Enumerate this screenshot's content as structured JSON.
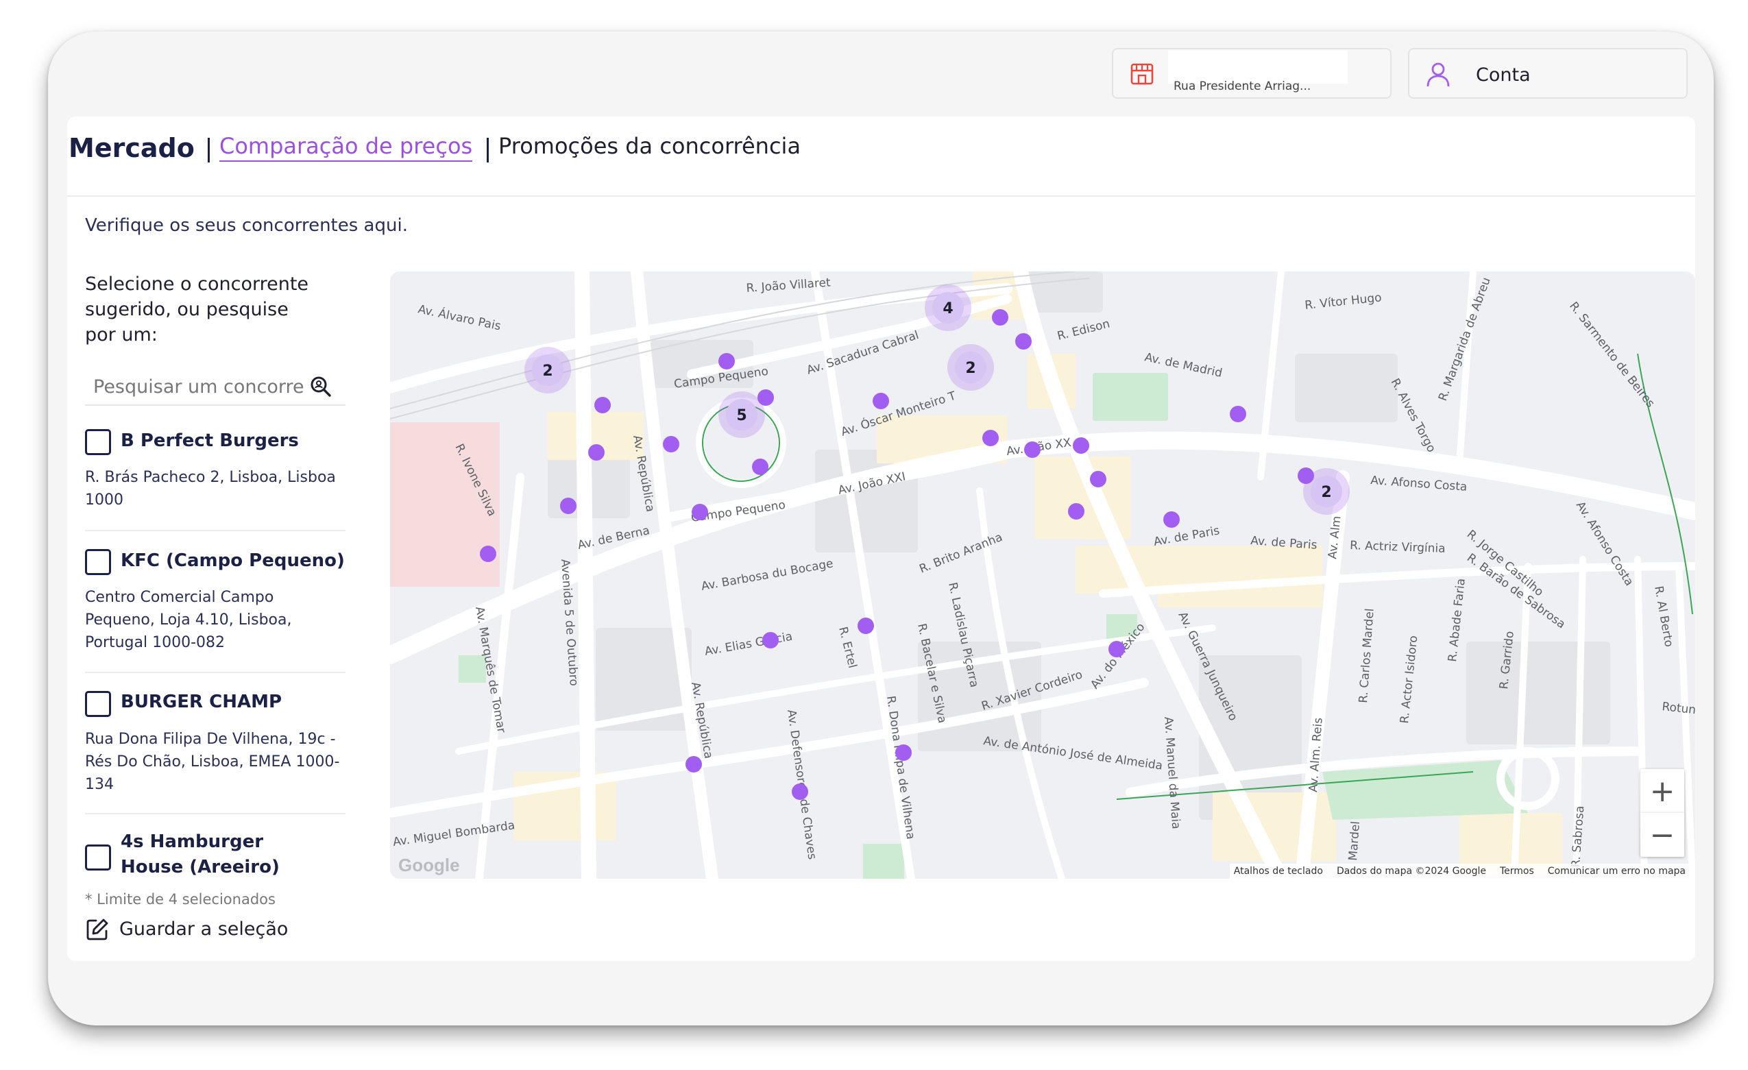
{
  "header": {
    "store_address": "Rua Presidente Arriag...",
    "account_label": "Conta"
  },
  "nav": {
    "title": "Mercado",
    "tabs": [
      {
        "label": "Comparação de preços",
        "active": true
      },
      {
        "label": "Promoções da concorrência",
        "active": false
      }
    ]
  },
  "intro": "Verifique os seus concorrentes aqui.",
  "sidebar": {
    "label": "Selecione o concorrente sugerido, ou pesquise por um:",
    "search_placeholder": "Pesquisar um concorrente",
    "competitors": [
      {
        "name": "B Perfect Burgers",
        "address": "R. Brás Pacheco 2, Lisboa, Lisboa 1000",
        "checked": false
      },
      {
        "name": "KFC (Campo Pequeno)",
        "address": "Centro Comercial Campo Pequeno, Loja 4.10, Lisboa, Portugal 1000-082",
        "checked": false
      },
      {
        "name": "BURGER CHAMP",
        "address": "Rua Dona Filipa De Vilhena, 19c - Rés Do Chão, Lisboa, EMEA 1000-134",
        "checked": false
      },
      {
        "name": "4s Hamburger House (Areeiro)",
        "address": "",
        "checked": false
      }
    ],
    "limit_note": "* Limite de 4 selecionados",
    "save_label": "Guardar a seleção"
  },
  "map": {
    "marker_color": "#a25ef0",
    "clusters": [
      "2",
      "4",
      "2",
      "5",
      "2"
    ],
    "streets": [
      "Av. Álvaro Pais",
      "R. João Villaret",
      "Av. Sacadura Cabral",
      "Campo Pequeno",
      "Av. Óscar Monteiro T",
      "R. Edison",
      "Av. de Madrid",
      "R. Vítor Hugo",
      "R. Margarida de Abreu",
      "R. Sarmento de Beires",
      "R. Alves Torgo",
      "Av. João XXI",
      "Av. João XX",
      "Av. Afonso Costa",
      "R. Ivone Silva",
      "Av. República",
      "Av. de Berna",
      "Campo Pequeno",
      "Av. Barbosa du Bocage",
      "R. Brito Aranha",
      "R. Ladislau Piçarra",
      "Av. de Paris",
      "Av. de Paris",
      "Av. Alm",
      "R. Actriz Virgínia",
      "R. Jorge Castilho",
      "R. Barão de Sabrosa",
      "Av. Afonso Costa",
      "Avenida 5 de Outubro",
      "Av. Marquês de Tomar",
      "Av. Elias Garcia",
      "R. Ertel",
      "R. Bacelar e Silva",
      "R. Xavier Cordeiro",
      "Av. do México",
      "Av. Guerra Junqueiro",
      "R. Carlos Mardel",
      "R. Actor Isidoro",
      "R. Abade Faria",
      "R. Garrido",
      "R. Al Berto",
      "Av. República",
      "Av. Defensores de Chaves",
      "R. Dona Filipa de Vilhena",
      "Av. de António José de Almeida",
      "Av. Manuel da Maia",
      "Av. Alm. Reis",
      "Av. Miguel Bombarda",
      "Mardel",
      "R. Sabrosa",
      "Rotund"
    ],
    "zoom_in": "+",
    "zoom_out": "−",
    "google": "Google",
    "attribution": [
      "Atalhos de teclado",
      "Dados do mapa ©2024 Google",
      "Termos",
      "Comunicar um erro no mapa"
    ]
  }
}
